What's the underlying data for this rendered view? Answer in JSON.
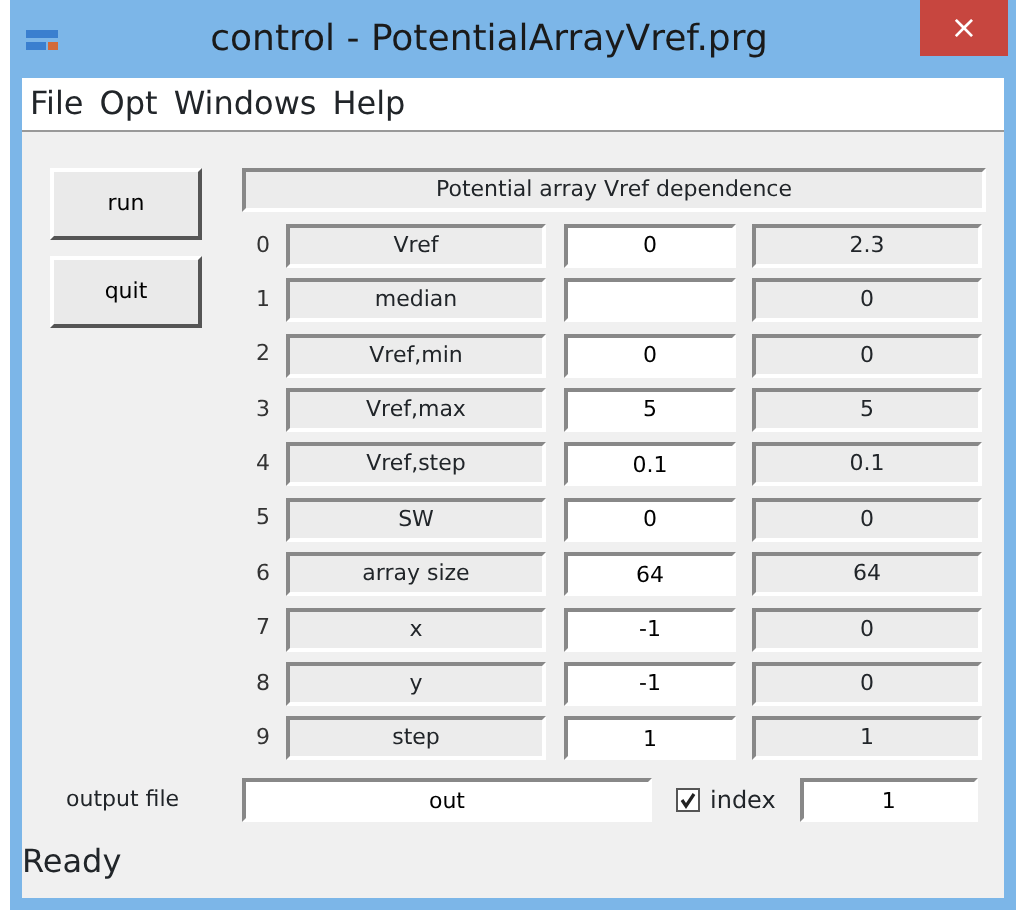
{
  "window": {
    "title": "control - PotentialArrayVref.prg",
    "close": "×"
  },
  "menu": [
    "File",
    "Opt",
    "Windows",
    "Help"
  ],
  "buttons": [
    "run",
    "quit"
  ],
  "header": "Potential array Vref dependence",
  "rows": [
    {
      "index": "0",
      "label": "Vref",
      "input": "0",
      "value": "2.3"
    },
    {
      "index": "1",
      "label": "median",
      "input": "",
      "value": "0"
    },
    {
      "index": "2",
      "label": "Vref,min",
      "input": "0",
      "value": "0"
    },
    {
      "index": "3",
      "label": "Vref,max",
      "input": "5",
      "value": "5"
    },
    {
      "index": "4",
      "label": "Vref,step",
      "input": "0.1",
      "value": "0.1"
    },
    {
      "index": "5",
      "label": "SW",
      "input": "0",
      "value": "0"
    },
    {
      "index": "6",
      "label": "array size",
      "input": "64",
      "value": "64"
    },
    {
      "index": "7",
      "label": "x",
      "input": "-1",
      "value": "0"
    },
    {
      "index": "8",
      "label": "y",
      "input": "-1",
      "value": "0"
    },
    {
      "index": "9",
      "label": "step",
      "input": "1",
      "value": "1"
    }
  ],
  "output": {
    "label": "output file",
    "file": "out",
    "index_checked": true,
    "index_label": "index",
    "index_value": "1"
  },
  "status_bar": "Ready"
}
